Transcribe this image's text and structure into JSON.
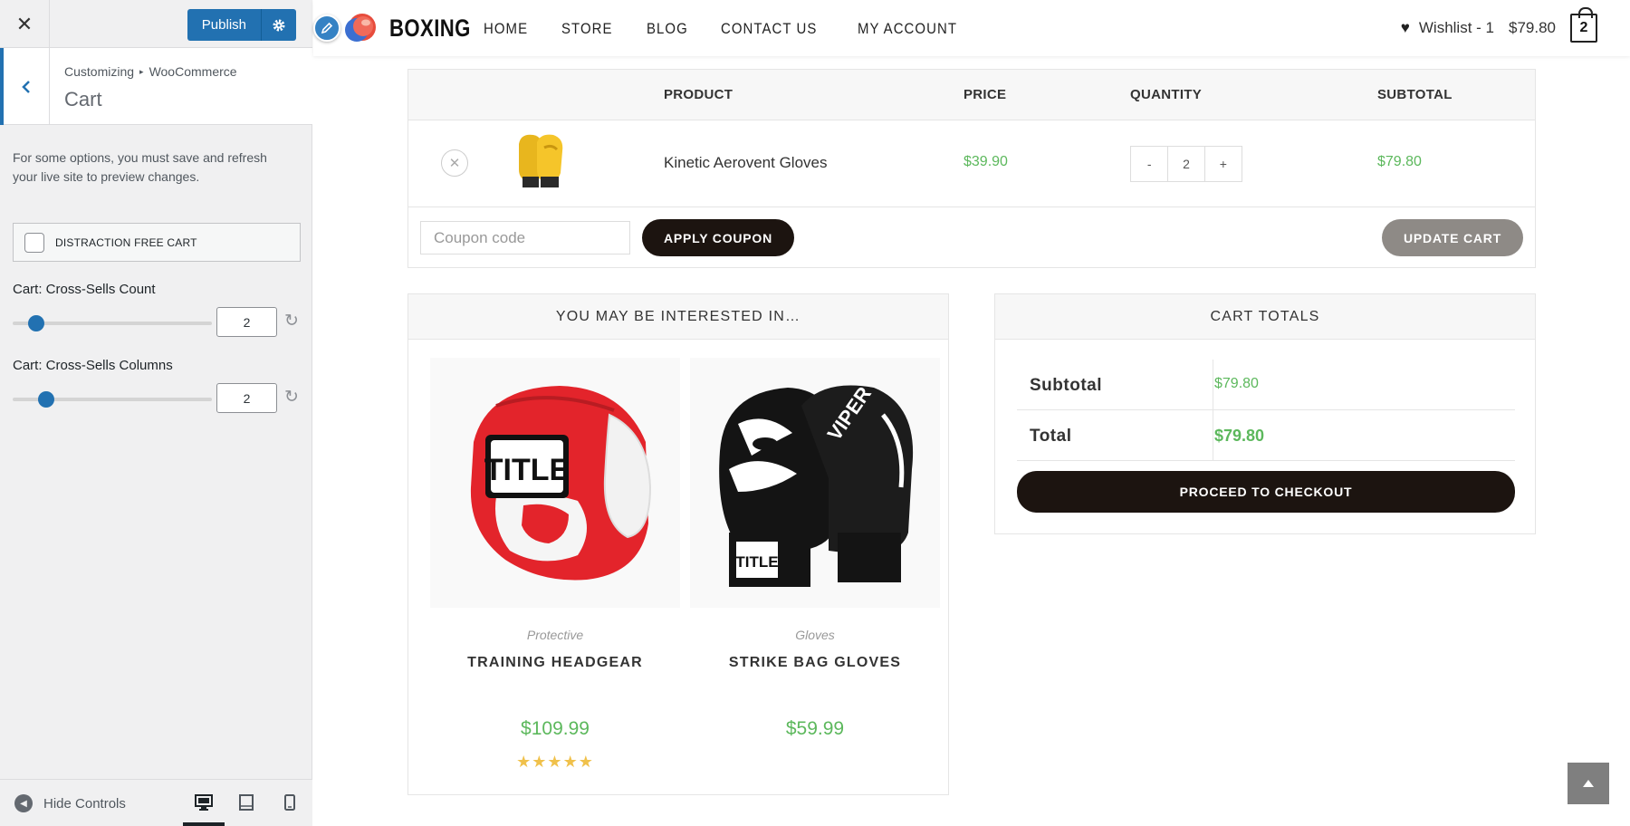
{
  "customizer": {
    "close_label": "✕",
    "publish_label": "Publish",
    "breadcrumb_parent": "Customizing",
    "breadcrumb_child": "WooCommerce",
    "section_title": "Cart",
    "description": "For some options, you must save and refresh your live site to preview changes.",
    "distraction_free_label": "DISTRACTION FREE CART",
    "distraction_free_checked": false,
    "cross_sells_count_label": "Cart: Cross-Sells Count",
    "cross_sells_count_value": "2",
    "cross_sells_count_slider_fraction": 0.12,
    "cross_sells_columns_label": "Cart: Cross-Sells Columns",
    "cross_sells_columns_value": "2",
    "cross_sells_columns_slider_fraction": 0.17,
    "hide_controls_label": "Hide Controls",
    "preview_devices": [
      "desktop-icon",
      "tablet-icon",
      "mobile-icon"
    ],
    "active_device": "desktop"
  },
  "site": {
    "logo_text": "BOXING",
    "nav": [
      "HOME",
      "STORE",
      "BLOG",
      "CONTACT US",
      "MY ACCOUNT"
    ],
    "wishlist_label": "Wishlist - 1",
    "cart_total": "$79.80",
    "cart_count": "2"
  },
  "cart": {
    "columns": [
      "PRODUCT",
      "PRICE",
      "QUANTITY",
      "SUBTOTAL"
    ],
    "items": [
      {
        "name": "Kinetic Aerovent Gloves",
        "price": "$39.90",
        "quantity": "2",
        "subtotal": "$79.80"
      }
    ],
    "qty_minus": "-",
    "qty_plus": "+",
    "coupon_placeholder": "Coupon code",
    "apply_coupon_label": "APPLY COUPON",
    "update_cart_label": "UPDATE CART"
  },
  "cross_sells": {
    "title": "YOU MAY BE INTERESTED IN…",
    "products": [
      {
        "category": "Protective",
        "name": "TRAINING HEADGEAR",
        "price": "$109.99",
        "rating": 5,
        "stars": "★★★★★"
      },
      {
        "category": "Gloves",
        "name": "STRIKE BAG GLOVES",
        "price": "$59.99"
      }
    ]
  },
  "totals": {
    "title": "CART TOTALS",
    "subtotal_label": "Subtotal",
    "subtotal_value": "$79.80",
    "total_label": "Total",
    "total_value": "$79.80",
    "checkout_label": "PROCEED TO CHECKOUT"
  },
  "colors": {
    "wp_blue": "#2271b1",
    "price_green": "#5cb85c",
    "button_dark": "#1c1410",
    "button_grey": "#8e8a86"
  }
}
